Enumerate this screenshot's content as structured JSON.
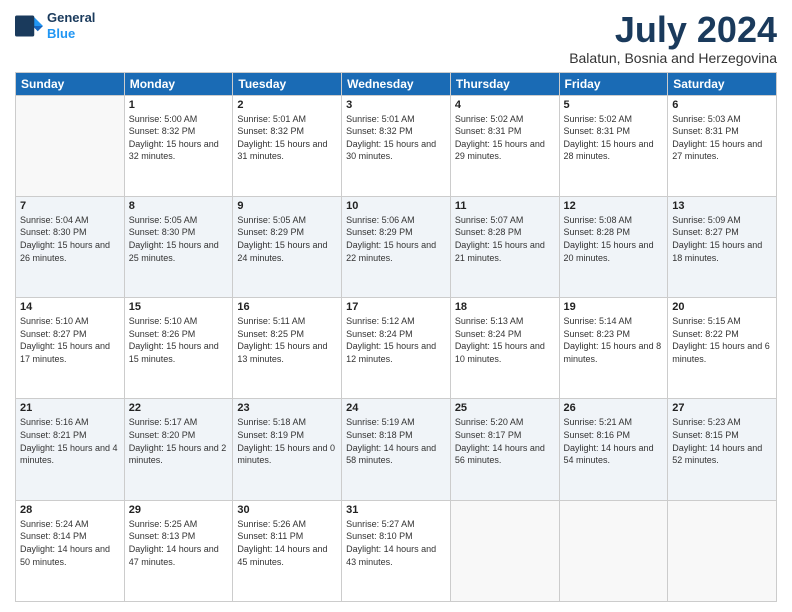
{
  "logo": {
    "line1": "General",
    "line2": "Blue"
  },
  "title": "July 2024",
  "location": "Balatun, Bosnia and Herzegovina",
  "weekdays": [
    "Sunday",
    "Monday",
    "Tuesday",
    "Wednesday",
    "Thursday",
    "Friday",
    "Saturday"
  ],
  "weeks": [
    [
      {
        "day": "",
        "sunrise": "",
        "sunset": "",
        "daylight": ""
      },
      {
        "day": "1",
        "sunrise": "Sunrise: 5:00 AM",
        "sunset": "Sunset: 8:32 PM",
        "daylight": "Daylight: 15 hours and 32 minutes."
      },
      {
        "day": "2",
        "sunrise": "Sunrise: 5:01 AM",
        "sunset": "Sunset: 8:32 PM",
        "daylight": "Daylight: 15 hours and 31 minutes."
      },
      {
        "day": "3",
        "sunrise": "Sunrise: 5:01 AM",
        "sunset": "Sunset: 8:32 PM",
        "daylight": "Daylight: 15 hours and 30 minutes."
      },
      {
        "day": "4",
        "sunrise": "Sunrise: 5:02 AM",
        "sunset": "Sunset: 8:31 PM",
        "daylight": "Daylight: 15 hours and 29 minutes."
      },
      {
        "day": "5",
        "sunrise": "Sunrise: 5:02 AM",
        "sunset": "Sunset: 8:31 PM",
        "daylight": "Daylight: 15 hours and 28 minutes."
      },
      {
        "day": "6",
        "sunrise": "Sunrise: 5:03 AM",
        "sunset": "Sunset: 8:31 PM",
        "daylight": "Daylight: 15 hours and 27 minutes."
      }
    ],
    [
      {
        "day": "7",
        "sunrise": "Sunrise: 5:04 AM",
        "sunset": "Sunset: 8:30 PM",
        "daylight": "Daylight: 15 hours and 26 minutes."
      },
      {
        "day": "8",
        "sunrise": "Sunrise: 5:05 AM",
        "sunset": "Sunset: 8:30 PM",
        "daylight": "Daylight: 15 hours and 25 minutes."
      },
      {
        "day": "9",
        "sunrise": "Sunrise: 5:05 AM",
        "sunset": "Sunset: 8:29 PM",
        "daylight": "Daylight: 15 hours and 24 minutes."
      },
      {
        "day": "10",
        "sunrise": "Sunrise: 5:06 AM",
        "sunset": "Sunset: 8:29 PM",
        "daylight": "Daylight: 15 hours and 22 minutes."
      },
      {
        "day": "11",
        "sunrise": "Sunrise: 5:07 AM",
        "sunset": "Sunset: 8:28 PM",
        "daylight": "Daylight: 15 hours and 21 minutes."
      },
      {
        "day": "12",
        "sunrise": "Sunrise: 5:08 AM",
        "sunset": "Sunset: 8:28 PM",
        "daylight": "Daylight: 15 hours and 20 minutes."
      },
      {
        "day": "13",
        "sunrise": "Sunrise: 5:09 AM",
        "sunset": "Sunset: 8:27 PM",
        "daylight": "Daylight: 15 hours and 18 minutes."
      }
    ],
    [
      {
        "day": "14",
        "sunrise": "Sunrise: 5:10 AM",
        "sunset": "Sunset: 8:27 PM",
        "daylight": "Daylight: 15 hours and 17 minutes."
      },
      {
        "day": "15",
        "sunrise": "Sunrise: 5:10 AM",
        "sunset": "Sunset: 8:26 PM",
        "daylight": "Daylight: 15 hours and 15 minutes."
      },
      {
        "day": "16",
        "sunrise": "Sunrise: 5:11 AM",
        "sunset": "Sunset: 8:25 PM",
        "daylight": "Daylight: 15 hours and 13 minutes."
      },
      {
        "day": "17",
        "sunrise": "Sunrise: 5:12 AM",
        "sunset": "Sunset: 8:24 PM",
        "daylight": "Daylight: 15 hours and 12 minutes."
      },
      {
        "day": "18",
        "sunrise": "Sunrise: 5:13 AM",
        "sunset": "Sunset: 8:24 PM",
        "daylight": "Daylight: 15 hours and 10 minutes."
      },
      {
        "day": "19",
        "sunrise": "Sunrise: 5:14 AM",
        "sunset": "Sunset: 8:23 PM",
        "daylight": "Daylight: 15 hours and 8 minutes."
      },
      {
        "day": "20",
        "sunrise": "Sunrise: 5:15 AM",
        "sunset": "Sunset: 8:22 PM",
        "daylight": "Daylight: 15 hours and 6 minutes."
      }
    ],
    [
      {
        "day": "21",
        "sunrise": "Sunrise: 5:16 AM",
        "sunset": "Sunset: 8:21 PM",
        "daylight": "Daylight: 15 hours and 4 minutes."
      },
      {
        "day": "22",
        "sunrise": "Sunrise: 5:17 AM",
        "sunset": "Sunset: 8:20 PM",
        "daylight": "Daylight: 15 hours and 2 minutes."
      },
      {
        "day": "23",
        "sunrise": "Sunrise: 5:18 AM",
        "sunset": "Sunset: 8:19 PM",
        "daylight": "Daylight: 15 hours and 0 minutes."
      },
      {
        "day": "24",
        "sunrise": "Sunrise: 5:19 AM",
        "sunset": "Sunset: 8:18 PM",
        "daylight": "Daylight: 14 hours and 58 minutes."
      },
      {
        "day": "25",
        "sunrise": "Sunrise: 5:20 AM",
        "sunset": "Sunset: 8:17 PM",
        "daylight": "Daylight: 14 hours and 56 minutes."
      },
      {
        "day": "26",
        "sunrise": "Sunrise: 5:21 AM",
        "sunset": "Sunset: 8:16 PM",
        "daylight": "Daylight: 14 hours and 54 minutes."
      },
      {
        "day": "27",
        "sunrise": "Sunrise: 5:23 AM",
        "sunset": "Sunset: 8:15 PM",
        "daylight": "Daylight: 14 hours and 52 minutes."
      }
    ],
    [
      {
        "day": "28",
        "sunrise": "Sunrise: 5:24 AM",
        "sunset": "Sunset: 8:14 PM",
        "daylight": "Daylight: 14 hours and 50 minutes."
      },
      {
        "day": "29",
        "sunrise": "Sunrise: 5:25 AM",
        "sunset": "Sunset: 8:13 PM",
        "daylight": "Daylight: 14 hours and 47 minutes."
      },
      {
        "day": "30",
        "sunrise": "Sunrise: 5:26 AM",
        "sunset": "Sunset: 8:11 PM",
        "daylight": "Daylight: 14 hours and 45 minutes."
      },
      {
        "day": "31",
        "sunrise": "Sunrise: 5:27 AM",
        "sunset": "Sunset: 8:10 PM",
        "daylight": "Daylight: 14 hours and 43 minutes."
      },
      {
        "day": "",
        "sunrise": "",
        "sunset": "",
        "daylight": ""
      },
      {
        "day": "",
        "sunrise": "",
        "sunset": "",
        "daylight": ""
      },
      {
        "day": "",
        "sunrise": "",
        "sunset": "",
        "daylight": ""
      }
    ]
  ]
}
